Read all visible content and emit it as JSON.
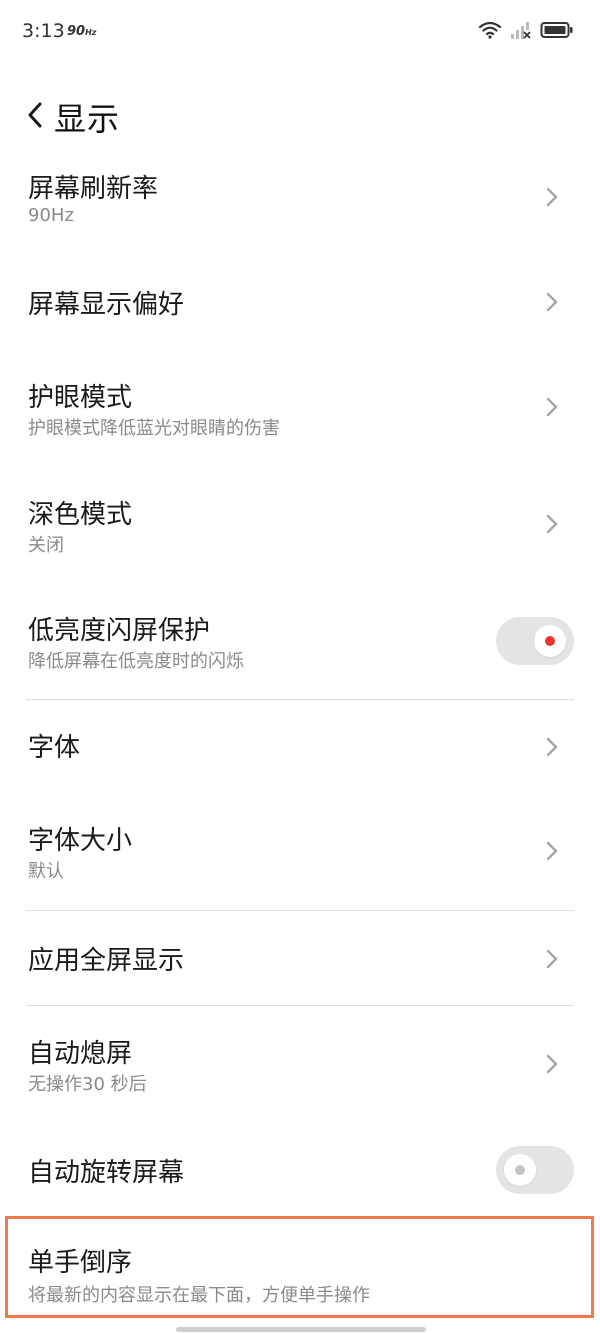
{
  "status_bar": {
    "time": "3:13",
    "refresh_label": "90",
    "refresh_unit": "Hz",
    "icons": [
      "wifi-icon",
      "signal-icon",
      "battery-icon"
    ]
  },
  "header": {
    "back_icon": "chevron-left-icon",
    "title": "显示"
  },
  "items": [
    {
      "id": "refresh-rate",
      "title": "屏幕刷新率",
      "subtitle": "90Hz",
      "control": "chevron"
    },
    {
      "id": "display-preference",
      "title": "屏幕显示偏好",
      "subtitle": "",
      "control": "chevron"
    },
    {
      "id": "eye-protection",
      "title": "护眼模式",
      "subtitle": "护眼模式降低蓝光对眼睛的伤害",
      "control": "chevron"
    },
    {
      "id": "dark-mode",
      "title": "深色模式",
      "subtitle": "关闭",
      "control": "chevron"
    },
    {
      "id": "low-brightness-flicker",
      "title": "低亮度闪屏保护",
      "subtitle": "降低屏幕在低亮度时的闪烁",
      "control": "toggle",
      "toggle_on": true
    },
    {
      "id": "font",
      "title": "字体",
      "subtitle": "",
      "control": "chevron"
    },
    {
      "id": "font-size",
      "title": "字体大小",
      "subtitle": "默认",
      "control": "chevron"
    },
    {
      "id": "app-fullscreen",
      "title": "应用全屏显示",
      "subtitle": "",
      "control": "chevron"
    },
    {
      "id": "auto-screen-off",
      "title": "自动熄屏",
      "subtitle": "无操作30 秒后",
      "control": "chevron"
    },
    {
      "id": "auto-rotate",
      "title": "自动旋转屏幕",
      "subtitle": "",
      "control": "toggle",
      "toggle_on": false
    },
    {
      "id": "one-hand-reverse",
      "title": "单手倒序",
      "subtitle": "将最新的内容显示在最下面，方便单手操作",
      "control": "none",
      "highlighted": true
    }
  ],
  "colors": {
    "toggle_track": "#e4e4e6",
    "toggle_on_dot": "#e8372d",
    "toggle_off_dot": "#c4c4c4",
    "highlight_border": "#f07a4a",
    "subtitle": "#8a8a8a",
    "chevron": "#a6a6a6"
  }
}
